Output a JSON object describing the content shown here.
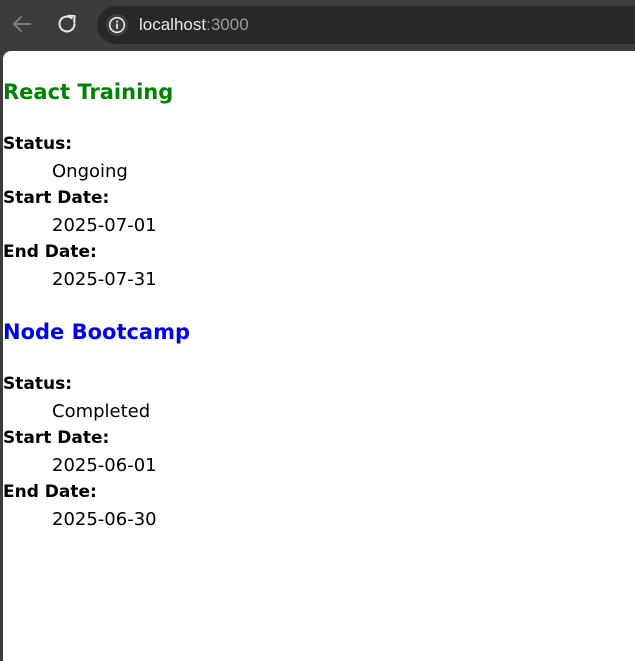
{
  "browser": {
    "url_host": "localhost",
    "url_port": ":3000"
  },
  "trainings": [
    {
      "title": "React Training",
      "title_color": "#008000",
      "status_label": "Status:",
      "status": "Ongoing",
      "start_label": "Start Date:",
      "start_date": "2025-07-01",
      "end_label": "End Date:",
      "end_date": "2025-07-31"
    },
    {
      "title": "Node Bootcamp",
      "title_color": "#0000e0",
      "status_label": "Status:",
      "status": "Completed",
      "start_label": "Start Date:",
      "start_date": "2025-06-01",
      "end_label": "End Date:",
      "end_date": "2025-06-30"
    }
  ]
}
